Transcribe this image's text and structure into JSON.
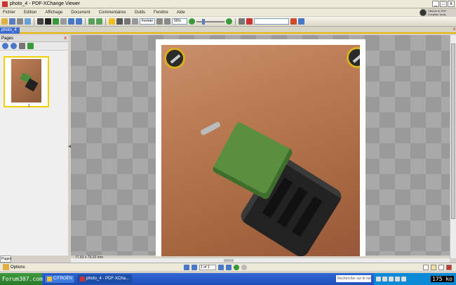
{
  "window": {
    "title": "photo_4 - PDF-XChange Viewer",
    "controls": [
      "_",
      "□",
      "x"
    ]
  },
  "menu": [
    "Fichier",
    "Edition",
    "Affichage",
    "Document",
    "Commentaires",
    "Outils",
    "Fenêtre",
    "Aide"
  ],
  "tracker": {
    "line1": "Obtenir le PDF",
    "line2": "Creation Tools"
  },
  "toolbar": {
    "zoom_field": "Fermer",
    "zoom_percent": "55%"
  },
  "tabs": {
    "active_label": "photo_4",
    "close": "x"
  },
  "left_pane": {
    "title": "Pages",
    "close": "x",
    "thumbnail_number": "1",
    "bottom_tab": "Pages"
  },
  "document": {
    "page_size_label": "77,83 x 79,20 mm"
  },
  "status_bar": {
    "options_label": "Options",
    "page_indicator": "1 of 1"
  },
  "taskbar": {
    "start_label": "Forum307.com",
    "buttons": [
      "CITROËN",
      "photo_4 - PDF-XCha..."
    ],
    "search_placeholder": "Rechercher sur le net",
    "clock": "175 ko"
  },
  "colors": {
    "tab_active": "#3c6ad0",
    "tab_underline": "#e8b600",
    "taskbar": "#1d4fb8",
    "thumb_highlight": "#f0d000"
  }
}
